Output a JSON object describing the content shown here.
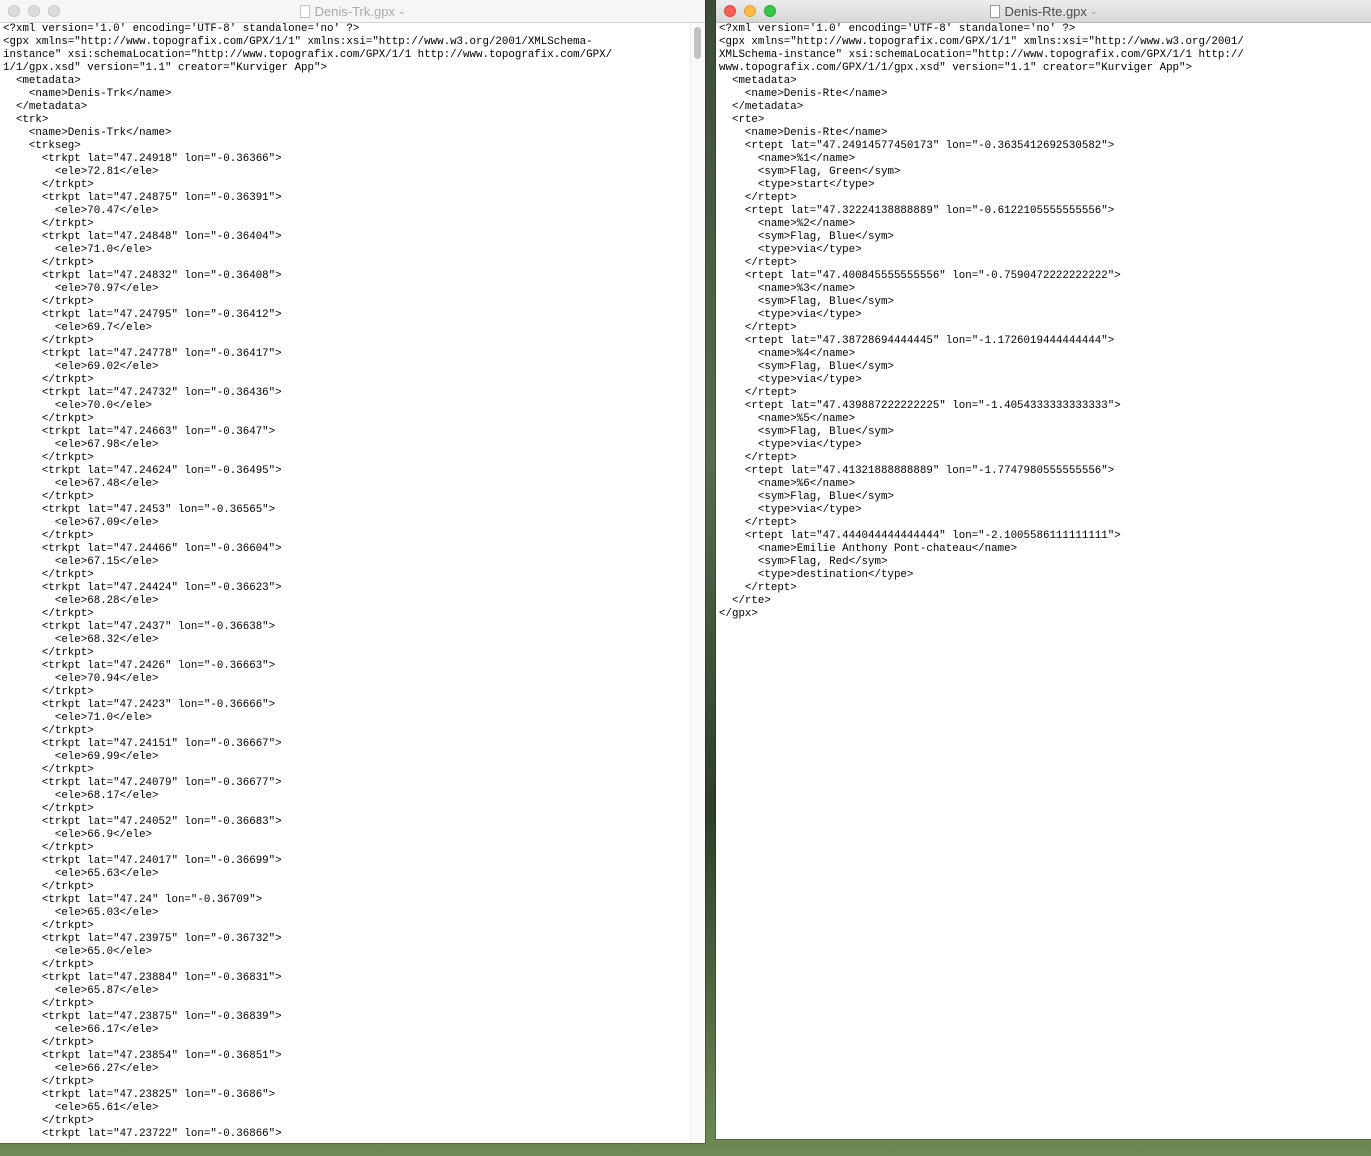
{
  "left_window": {
    "title": "Denis-Trk.gpx",
    "lines": [
      "<?xml version='1.0' encoding='UTF-8' standalone='no' ?>",
      "<gpx xmlns=\"http://www.topografix.com/GPX/1/1\" xmlns:xsi=\"http://www.w3.org/2001/XMLSchema-",
      "instance\" xsi:schemaLocation=\"http://www.topografix.com/GPX/1/1 http://www.topografix.com/GPX/",
      "1/1/gpx.xsd\" version=\"1.1\" creator=\"Kurviger App\">",
      "  <metadata>",
      "    <name>Denis-Trk</name>",
      "  </metadata>",
      "  <trk>",
      "    <name>Denis-Trk</name>",
      "    <trkseg>",
      "      <trkpt lat=\"47.24918\" lon=\"-0.36366\">",
      "        <ele>72.81</ele>",
      "      </trkpt>",
      "      <trkpt lat=\"47.24875\" lon=\"-0.36391\">",
      "        <ele>70.47</ele>",
      "      </trkpt>",
      "      <trkpt lat=\"47.24848\" lon=\"-0.36404\">",
      "        <ele>71.0</ele>",
      "      </trkpt>",
      "      <trkpt lat=\"47.24832\" lon=\"-0.36408\">",
      "        <ele>70.97</ele>",
      "      </trkpt>",
      "      <trkpt lat=\"47.24795\" lon=\"-0.36412\">",
      "        <ele>69.7</ele>",
      "      </trkpt>",
      "      <trkpt lat=\"47.24778\" lon=\"-0.36417\">",
      "        <ele>69.02</ele>",
      "      </trkpt>",
      "      <trkpt lat=\"47.24732\" lon=\"-0.36436\">",
      "        <ele>70.0</ele>",
      "      </trkpt>",
      "      <trkpt lat=\"47.24663\" lon=\"-0.3647\">",
      "        <ele>67.98</ele>",
      "      </trkpt>",
      "      <trkpt lat=\"47.24624\" lon=\"-0.36495\">",
      "        <ele>67.48</ele>",
      "      </trkpt>",
      "      <trkpt lat=\"47.2453\" lon=\"-0.36565\">",
      "        <ele>67.09</ele>",
      "      </trkpt>",
      "      <trkpt lat=\"47.24466\" lon=\"-0.36604\">",
      "        <ele>67.15</ele>",
      "      </trkpt>",
      "      <trkpt lat=\"47.24424\" lon=\"-0.36623\">",
      "        <ele>68.28</ele>",
      "      </trkpt>",
      "      <trkpt lat=\"47.2437\" lon=\"-0.36638\">",
      "        <ele>68.32</ele>",
      "      </trkpt>",
      "      <trkpt lat=\"47.2426\" lon=\"-0.36663\">",
      "        <ele>70.94</ele>",
      "      </trkpt>",
      "      <trkpt lat=\"47.2423\" lon=\"-0.36666\">",
      "        <ele>71.0</ele>",
      "      </trkpt>",
      "      <trkpt lat=\"47.24151\" lon=\"-0.36667\">",
      "        <ele>69.99</ele>",
      "      </trkpt>",
      "      <trkpt lat=\"47.24079\" lon=\"-0.36677\">",
      "        <ele>68.17</ele>",
      "      </trkpt>",
      "      <trkpt lat=\"47.24052\" lon=\"-0.36683\">",
      "        <ele>66.9</ele>",
      "      </trkpt>",
      "      <trkpt lat=\"47.24017\" lon=\"-0.36699\">",
      "        <ele>65.63</ele>",
      "      </trkpt>",
      "      <trkpt lat=\"47.24\" lon=\"-0.36709\">",
      "        <ele>65.03</ele>",
      "      </trkpt>",
      "      <trkpt lat=\"47.23975\" lon=\"-0.36732\">",
      "        <ele>65.0</ele>",
      "      </trkpt>",
      "      <trkpt lat=\"47.23884\" lon=\"-0.36831\">",
      "        <ele>65.87</ele>",
      "      </trkpt>",
      "      <trkpt lat=\"47.23875\" lon=\"-0.36839\">",
      "        <ele>66.17</ele>",
      "      </trkpt>",
      "      <trkpt lat=\"47.23854\" lon=\"-0.36851\">",
      "        <ele>66.27</ele>",
      "      </trkpt>",
      "      <trkpt lat=\"47.23825\" lon=\"-0.3686\">",
      "        <ele>65.61</ele>",
      "      </trkpt>",
      "      <trkpt lat=\"47.23722\" lon=\"-0.36866\">"
    ]
  },
  "right_window": {
    "title": "Denis-Rte.gpx",
    "lines": [
      "<?xml version='1.0' encoding='UTF-8' standalone='no' ?>",
      "<gpx xmlns=\"http://www.topografix.com/GPX/1/1\" xmlns:xsi=\"http://www.w3.org/2001/",
      "XMLSchema-instance\" xsi:schemaLocation=\"http://www.topografix.com/GPX/1/1 http://",
      "www.topografix.com/GPX/1/1/gpx.xsd\" version=\"1.1\" creator=\"Kurviger App\">",
      "  <metadata>",
      "    <name>Denis-Rte</name>",
      "  </metadata>",
      "  <rte>",
      "    <name>Denis-Rte</name>",
      "    <rtept lat=\"47.24914577450173\" lon=\"-0.3635412692530582\">",
      "      <name>%1</name>",
      "      <sym>Flag, Green</sym>",
      "      <type>start</type>",
      "    </rtept>",
      "    <rtept lat=\"47.32224138888889\" lon=\"-0.6122105555555556\">",
      "      <name>%2</name>",
      "      <sym>Flag, Blue</sym>",
      "      <type>via</type>",
      "    </rtept>",
      "    <rtept lat=\"47.400845555555556\" lon=\"-0.7590472222222222\">",
      "      <name>%3</name>",
      "      <sym>Flag, Blue</sym>",
      "      <type>via</type>",
      "    </rtept>",
      "    <rtept lat=\"47.38728694444445\" lon=\"-1.1726019444444444\">",
      "      <name>%4</name>",
      "      <sym>Flag, Blue</sym>",
      "      <type>via</type>",
      "    </rtept>",
      "    <rtept lat=\"47.439887222222225\" lon=\"-1.4054333333333333\">",
      "      <name>%5</name>",
      "      <sym>Flag, Blue</sym>",
      "      <type>via</type>",
      "    </rtept>",
      "    <rtept lat=\"47.41321888888889\" lon=\"-1.7747980555555556\">",
      "      <name>%6</name>",
      "      <sym>Flag, Blue</sym>",
      "      <type>via</type>",
      "    </rtept>",
      "    <rtept lat=\"47.444044444444444\" lon=\"-2.1005586111111111\">",
      "      <name>Emilie Anthony Pont-chateau</name>",
      "      <sym>Flag, Red</sym>",
      "      <type>destination</type>",
      "    </rtept>",
      "  </rte>",
      "</gpx>"
    ]
  }
}
